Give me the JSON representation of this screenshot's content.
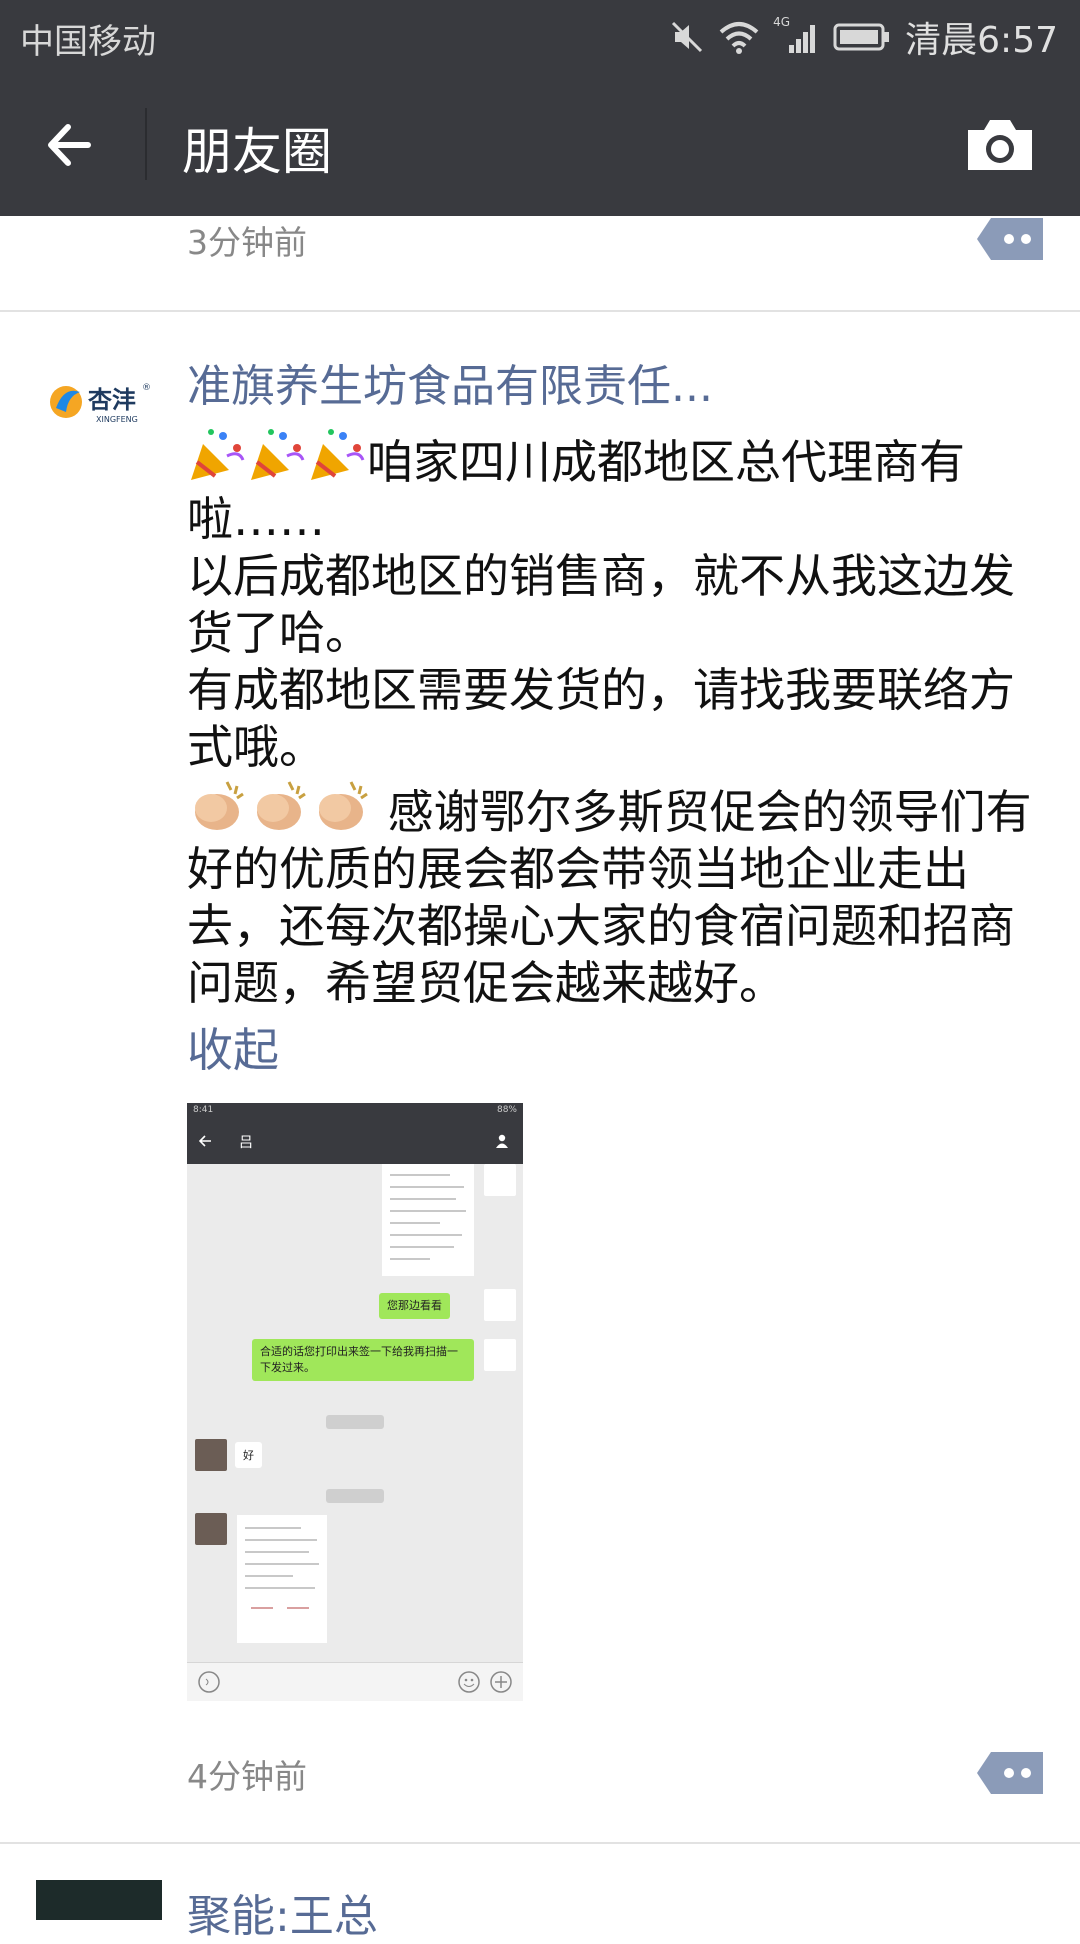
{
  "status_bar": {
    "carrier": "中国移动",
    "network": "4G",
    "time": "清晨6:57"
  },
  "nav": {
    "title": "朋友圈",
    "back_icon": "arrow-left-icon",
    "camera_icon": "camera-icon"
  },
  "previous_post": {
    "time": "3分钟前"
  },
  "post": {
    "avatar_logo_text": "杏沣",
    "avatar_logo_sub": "XINGFENG",
    "author": "准旗养生坊食品有限责任...",
    "line1": "咱家四川成都地区总代理商有啦……",
    "line2": "以后成都地区的销售商，就不从我这边发货了哈。",
    "line3": "有成都地区需要发货的，请找我要联络方式哦。",
    "line4": "感谢鄂尔多斯贸促会的领导们有好的优质的展会都会带领当地企业走出去，还每次都操心大家的食宿问题和招商问题，希望贸促会越来越好。",
    "collapse_label": "收起",
    "time": "4分钟前",
    "screenshot": {
      "status_time": "8:41",
      "battery": "88%",
      "chat_title": "吕",
      "msg1": "您那边看看",
      "msg2": "合适的话您打印出来签一下给我再扫描一下发过来。",
      "time_stamp1": "昨天 13:03",
      "reply": "好",
      "time_stamp2": "昨天 13:35"
    }
  },
  "next_post": {
    "author": "聚能:王总"
  },
  "colors": {
    "bar": "#393a3f",
    "link": "#576b95",
    "more_button": "#8b9bb8"
  }
}
